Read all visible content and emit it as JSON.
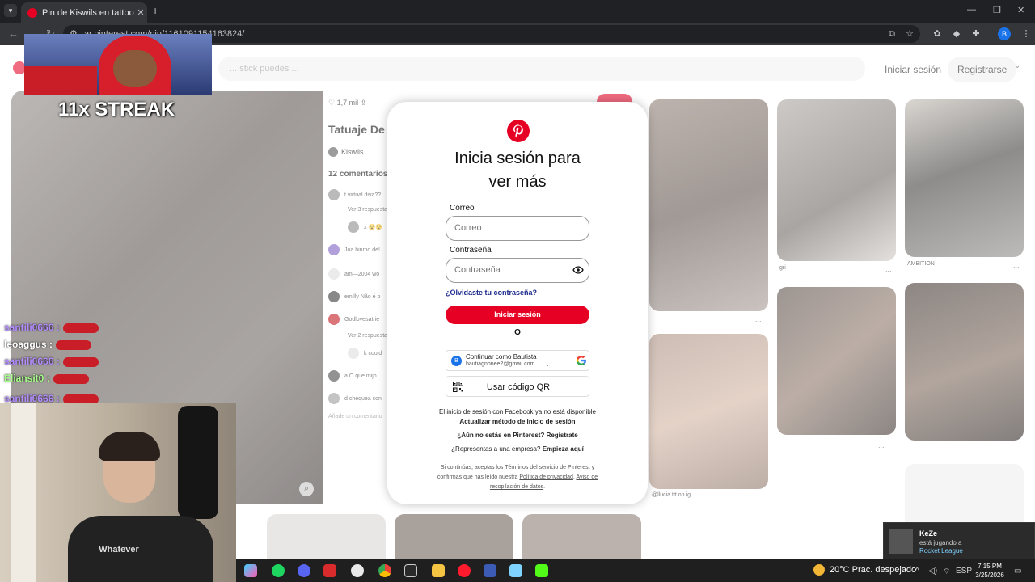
{
  "browser": {
    "tab_title": "Pin de Kiswils en tattoo | Tatuaje",
    "tab_close": "✕",
    "new_tab": "+",
    "url": "ar.pinterest.com/pin/1161091154163824/",
    "profile_initial": "B"
  },
  "pinterest": {
    "search_placeholder": "... stick puedes ...",
    "header_login": "Iniciar sesión",
    "header_register": "Registrarse",
    "pin": {
      "likes": "1,7 mil",
      "title": "Tatuaje De",
      "author": "Kiswils",
      "comments_count": "12 comentarios",
      "comments": [
        {
          "text": "t virtual diva??"
        },
        {
          "text": "Ver 3 respuestas"
        },
        {
          "text": "x 😵😵"
        },
        {
          "text": "Joa  hinmo de!"
        },
        {
          "text": "am—2004  wo"
        },
        {
          "text": "emilly  Não é p"
        },
        {
          "text": "Godlovesatrie"
        },
        {
          "text": "Ver 2 respuestas"
        },
        {
          "text": "k  could"
        },
        {
          "text": "a  O que mijo"
        },
        {
          "text": "d  chequea con"
        }
      ],
      "add_comment": "Añade un comentario"
    },
    "grid_labels": {
      "g1": "gri",
      "g2": "AMBITION",
      "g3": "@llucia.ttt on ig"
    },
    "dots": "..."
  },
  "modal": {
    "title": "Inicia sesión para ver más",
    "email_label": "Correo",
    "email_placeholder": "Correo",
    "password_label": "Contraseña",
    "password_placeholder": "Contraseña",
    "forgot": "¿Olvidaste tu contraseña?",
    "login_button": "Iniciar sesión",
    "or": "O",
    "google": {
      "name": "Continuar como Bautista",
      "email": "bautiagnonee2@gmail.com",
      "initial": "B"
    },
    "qr_button": "Usar código QR",
    "facebook_note": "El inicio de sesión con Facebook ya no está disponible",
    "update_method": "Actualizar método de inicio de sesión",
    "not_on_pinterest": "¿Aún no estás en Pinterest? Regístrate",
    "business_prefix": "¿Representas a una empresa?",
    "business_link": "Empieza aquí",
    "legal": {
      "p1": "Si continúas, aceptas los",
      "terms": "Términos del servicio",
      "p2": "de Pinterest y confirmas que has leído nuestra",
      "privacy": "Política de privacidad",
      "p3": ".",
      "collection": "Aviso de recopilación de datos",
      "p4": "."
    }
  },
  "stream": {
    "streak": "11x STREAK",
    "chat": [
      {
        "user": "santili0666 :",
        "color": "#b38cff"
      },
      {
        "user": "leoaggus :",
        "color": "#ffffff"
      },
      {
        "user": "santili0666 :",
        "color": "#b38cff"
      },
      {
        "user": "Eliansit0 :",
        "color": "#a8ff8a"
      },
      {
        "user": "santili0666 :",
        "color": "#b38cff"
      }
    ],
    "hoodie_text": "Whatever"
  },
  "notification": {
    "name": "KeZe",
    "status": "está jugando a",
    "game": "Rocket League"
  },
  "taskbar": {
    "weather": "20°C  Prac. despejado",
    "lang": "ESP",
    "time": "7:15 PM",
    "date": "3/25/2026"
  }
}
